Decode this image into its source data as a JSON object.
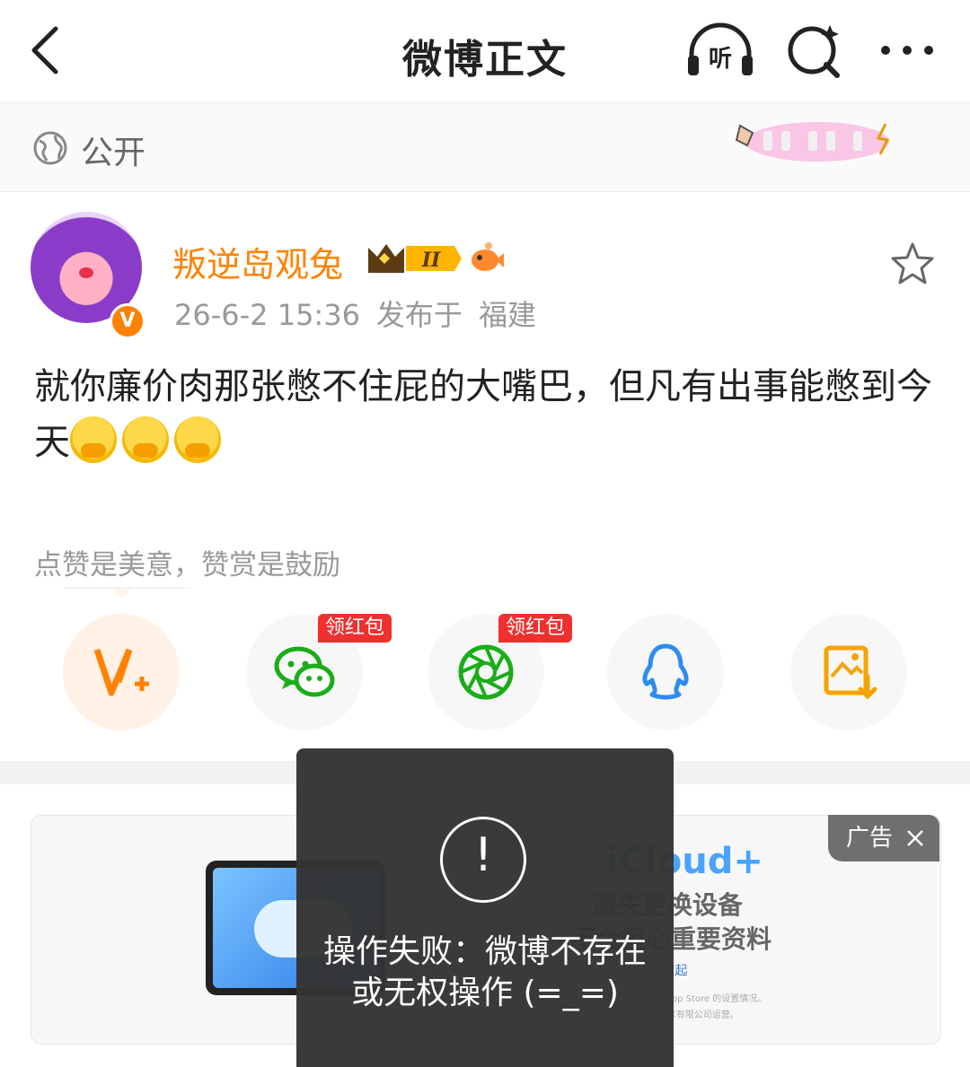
{
  "topbar": {
    "title": "微博正文",
    "listen_label": "听"
  },
  "visibility": {
    "label": "公开"
  },
  "post": {
    "author": "叛逆岛观兔",
    "verified_badge": "V",
    "level_badge": "II",
    "time": "26-6-2 15:36",
    "location_prefix": "发布于",
    "location": "福建",
    "text": "就你廉价肉那张憋不住屁的大嘴巴，但凡有出事能憋到今天",
    "emoji_count": 3
  },
  "like_tip": "点赞是美意，赞赏是鼓励",
  "share": {
    "items": [
      {
        "name": "vplus",
        "tag": ""
      },
      {
        "name": "wechat",
        "tag": "领红包"
      },
      {
        "name": "moments",
        "tag": "领红包"
      },
      {
        "name": "qq",
        "tag": ""
      },
      {
        "name": "save-image",
        "tag": ""
      }
    ]
  },
  "ad": {
    "tag": "广告",
    "title": "iCloud+",
    "line1": "遗失更换设备",
    "line2": "不会担心重要资料",
    "price": "¥6/月起",
    "fine1": "App 在 App Store 的设置情况。",
    "fine2": "(贵州)技术有限公司运营。"
  },
  "toast": {
    "icon": "!",
    "message": "操作失败：微博不存在或无权操作 (=_=)"
  },
  "colors": {
    "brand_orange": "#ff8200",
    "red_tag": "#f0302f",
    "wechat_green": "#1aad19",
    "qq_blue": "#2d8cf0"
  }
}
